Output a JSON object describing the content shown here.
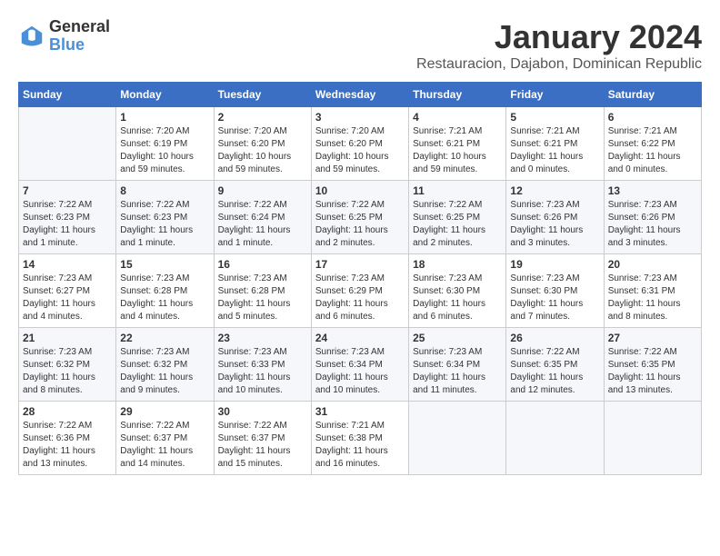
{
  "logo": {
    "general": "General",
    "blue": "Blue"
  },
  "title": {
    "month": "January 2024",
    "location": "Restauracion, Dajabon, Dominican Republic"
  },
  "headers": [
    "Sunday",
    "Monday",
    "Tuesday",
    "Wednesday",
    "Thursday",
    "Friday",
    "Saturday"
  ],
  "weeks": [
    [
      {
        "day": "",
        "info": ""
      },
      {
        "day": "1",
        "info": "Sunrise: 7:20 AM\nSunset: 6:19 PM\nDaylight: 10 hours\nand 59 minutes."
      },
      {
        "day": "2",
        "info": "Sunrise: 7:20 AM\nSunset: 6:20 PM\nDaylight: 10 hours\nand 59 minutes."
      },
      {
        "day": "3",
        "info": "Sunrise: 7:20 AM\nSunset: 6:20 PM\nDaylight: 10 hours\nand 59 minutes."
      },
      {
        "day": "4",
        "info": "Sunrise: 7:21 AM\nSunset: 6:21 PM\nDaylight: 10 hours\nand 59 minutes."
      },
      {
        "day": "5",
        "info": "Sunrise: 7:21 AM\nSunset: 6:21 PM\nDaylight: 11 hours\nand 0 minutes."
      },
      {
        "day": "6",
        "info": "Sunrise: 7:21 AM\nSunset: 6:22 PM\nDaylight: 11 hours\nand 0 minutes."
      }
    ],
    [
      {
        "day": "7",
        "info": "Sunrise: 7:22 AM\nSunset: 6:23 PM\nDaylight: 11 hours\nand 1 minute."
      },
      {
        "day": "8",
        "info": "Sunrise: 7:22 AM\nSunset: 6:23 PM\nDaylight: 11 hours\nand 1 minute."
      },
      {
        "day": "9",
        "info": "Sunrise: 7:22 AM\nSunset: 6:24 PM\nDaylight: 11 hours\nand 1 minute."
      },
      {
        "day": "10",
        "info": "Sunrise: 7:22 AM\nSunset: 6:25 PM\nDaylight: 11 hours\nand 2 minutes."
      },
      {
        "day": "11",
        "info": "Sunrise: 7:22 AM\nSunset: 6:25 PM\nDaylight: 11 hours\nand 2 minutes."
      },
      {
        "day": "12",
        "info": "Sunrise: 7:23 AM\nSunset: 6:26 PM\nDaylight: 11 hours\nand 3 minutes."
      },
      {
        "day": "13",
        "info": "Sunrise: 7:23 AM\nSunset: 6:26 PM\nDaylight: 11 hours\nand 3 minutes."
      }
    ],
    [
      {
        "day": "14",
        "info": "Sunrise: 7:23 AM\nSunset: 6:27 PM\nDaylight: 11 hours\nand 4 minutes."
      },
      {
        "day": "15",
        "info": "Sunrise: 7:23 AM\nSunset: 6:28 PM\nDaylight: 11 hours\nand 4 minutes."
      },
      {
        "day": "16",
        "info": "Sunrise: 7:23 AM\nSunset: 6:28 PM\nDaylight: 11 hours\nand 5 minutes."
      },
      {
        "day": "17",
        "info": "Sunrise: 7:23 AM\nSunset: 6:29 PM\nDaylight: 11 hours\nand 6 minutes."
      },
      {
        "day": "18",
        "info": "Sunrise: 7:23 AM\nSunset: 6:30 PM\nDaylight: 11 hours\nand 6 minutes."
      },
      {
        "day": "19",
        "info": "Sunrise: 7:23 AM\nSunset: 6:30 PM\nDaylight: 11 hours\nand 7 minutes."
      },
      {
        "day": "20",
        "info": "Sunrise: 7:23 AM\nSunset: 6:31 PM\nDaylight: 11 hours\nand 8 minutes."
      }
    ],
    [
      {
        "day": "21",
        "info": "Sunrise: 7:23 AM\nSunset: 6:32 PM\nDaylight: 11 hours\nand 8 minutes."
      },
      {
        "day": "22",
        "info": "Sunrise: 7:23 AM\nSunset: 6:32 PM\nDaylight: 11 hours\nand 9 minutes."
      },
      {
        "day": "23",
        "info": "Sunrise: 7:23 AM\nSunset: 6:33 PM\nDaylight: 11 hours\nand 10 minutes."
      },
      {
        "day": "24",
        "info": "Sunrise: 7:23 AM\nSunset: 6:34 PM\nDaylight: 11 hours\nand 10 minutes."
      },
      {
        "day": "25",
        "info": "Sunrise: 7:23 AM\nSunset: 6:34 PM\nDaylight: 11 hours\nand 11 minutes."
      },
      {
        "day": "26",
        "info": "Sunrise: 7:22 AM\nSunset: 6:35 PM\nDaylight: 11 hours\nand 12 minutes."
      },
      {
        "day": "27",
        "info": "Sunrise: 7:22 AM\nSunset: 6:35 PM\nDaylight: 11 hours\nand 13 minutes."
      }
    ],
    [
      {
        "day": "28",
        "info": "Sunrise: 7:22 AM\nSunset: 6:36 PM\nDaylight: 11 hours\nand 13 minutes."
      },
      {
        "day": "29",
        "info": "Sunrise: 7:22 AM\nSunset: 6:37 PM\nDaylight: 11 hours\nand 14 minutes."
      },
      {
        "day": "30",
        "info": "Sunrise: 7:22 AM\nSunset: 6:37 PM\nDaylight: 11 hours\nand 15 minutes."
      },
      {
        "day": "31",
        "info": "Sunrise: 7:21 AM\nSunset: 6:38 PM\nDaylight: 11 hours\nand 16 minutes."
      },
      {
        "day": "",
        "info": ""
      },
      {
        "day": "",
        "info": ""
      },
      {
        "day": "",
        "info": ""
      }
    ]
  ]
}
